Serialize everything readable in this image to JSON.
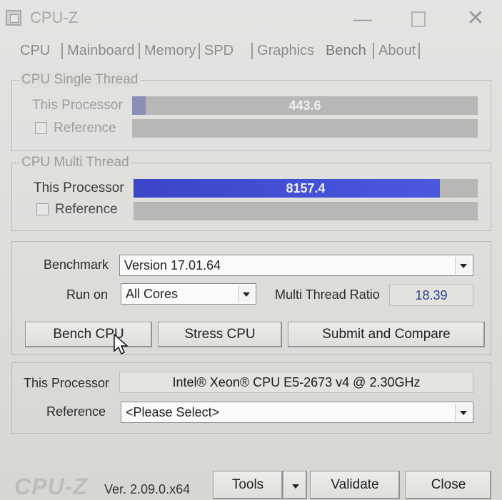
{
  "window": {
    "title": "CPU-Z"
  },
  "tabs": [
    {
      "label": "CPU"
    },
    {
      "label": "Mainboard"
    },
    {
      "label": "Memory"
    },
    {
      "label": "SPD"
    },
    {
      "label": "Graphics"
    },
    {
      "label": "Bench"
    },
    {
      "label": "About"
    }
  ],
  "single_thread": {
    "title": "CPU Single Thread",
    "this_label": "This Processor",
    "this_value": "443.6",
    "this_fraction": 0.04,
    "reference_label": "Reference",
    "reference_checked": false
  },
  "multi_thread": {
    "title": "CPU Multi Thread",
    "this_label": "This Processor",
    "this_value": "8157.4",
    "this_fraction": 0.89,
    "reference_label": "Reference",
    "reference_checked": false
  },
  "settings": {
    "benchmark_label": "Benchmark",
    "benchmark_value": "Version 17.01.64",
    "runon_label": "Run on",
    "runon_value": "All Cores",
    "ratio_label": "Multi Thread Ratio",
    "ratio_value": "18.39"
  },
  "actions": {
    "bench": "Bench CPU",
    "stress": "Stress CPU",
    "submit": "Submit and Compare"
  },
  "processor": {
    "this_label": "This Processor",
    "this_value": "Intel® Xeon® CPU E5-2673 v4 @ 2.30GHz",
    "reference_label": "Reference",
    "reference_value": "<Please Select>"
  },
  "footer": {
    "logo": "CPU-Z",
    "version": "Ver. 2.09.0.x64",
    "tools": "Tools",
    "validate": "Validate",
    "close": "Close"
  },
  "colors": {
    "multi_fill": "#3c45c8",
    "single_fill": "#8a8fb8"
  }
}
